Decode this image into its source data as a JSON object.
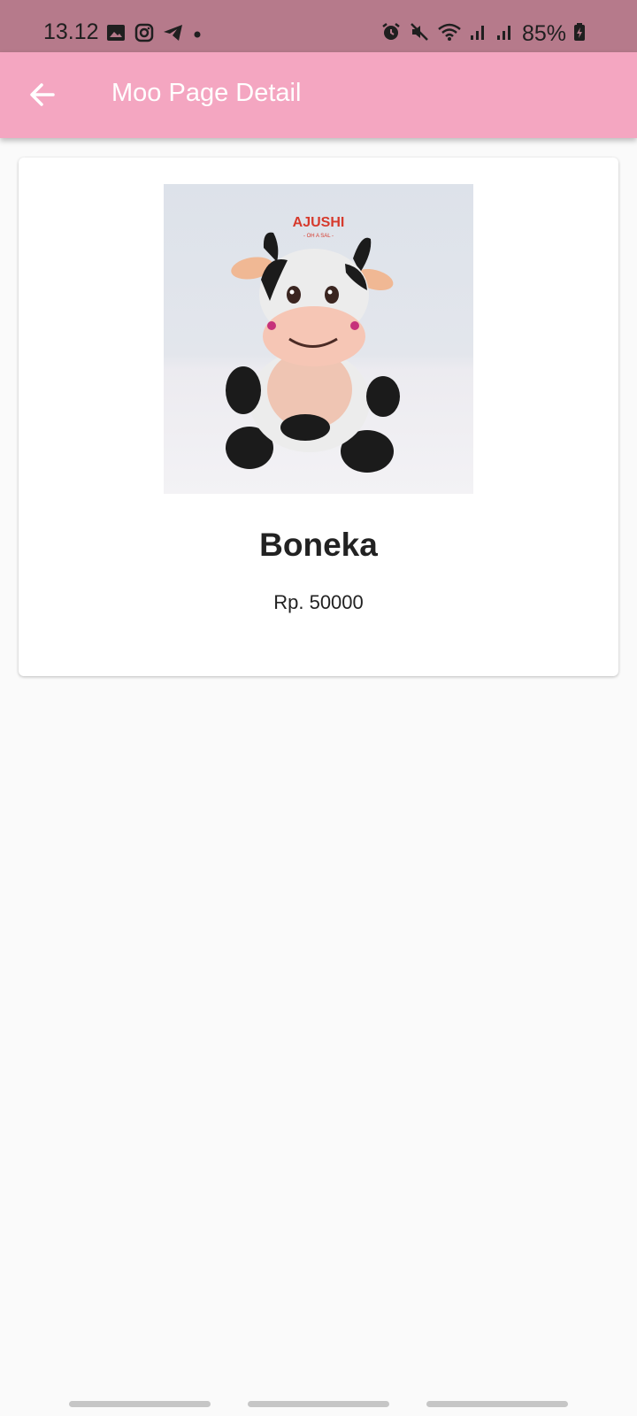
{
  "status_bar": {
    "time": "13.12",
    "battery": "85%",
    "left_icons": [
      "gallery-icon",
      "instagram-icon",
      "telegram-icon",
      "dot-icon"
    ],
    "right_icons": [
      "alarm-icon",
      "mute-icon",
      "wifi-icon",
      "signal-icon",
      "signal-icon",
      "battery-icon"
    ]
  },
  "appbar": {
    "title": "Moo Page Detail",
    "back_icon": "arrow-back-icon",
    "color": "#f4a6c1"
  },
  "product": {
    "name": "Boneka",
    "price": "Rp. 50000",
    "image_brand": "AJUSHI",
    "image_tagline": "- OH A SAL -"
  },
  "colors": {
    "status_bar": "#b67a8b",
    "background": "#fafafa",
    "card": "#ffffff"
  }
}
